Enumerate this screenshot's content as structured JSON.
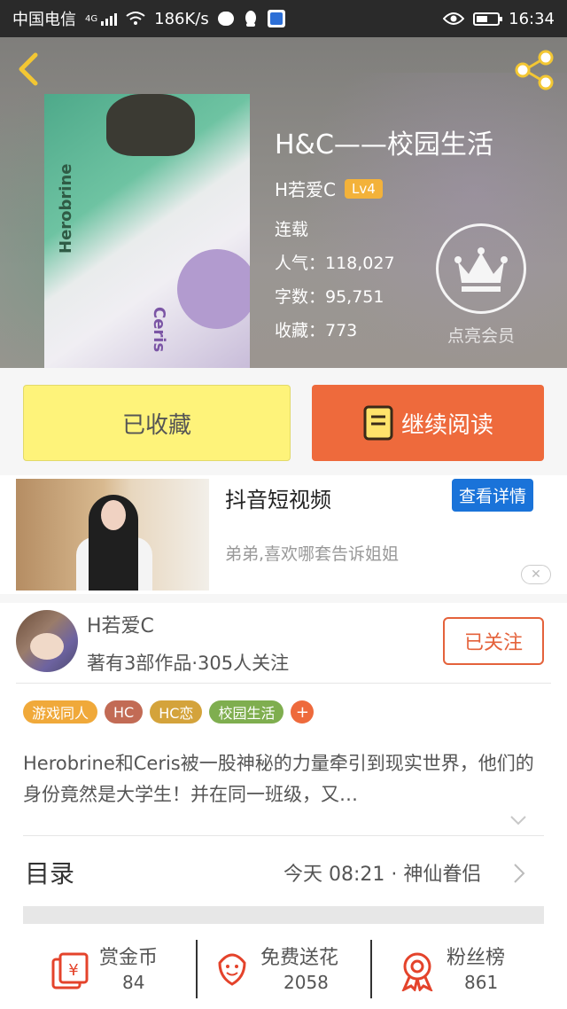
{
  "status_bar": {
    "carrier": "中国电信",
    "network": "4G",
    "speed": "186K/s",
    "time": "16:34"
  },
  "book": {
    "title": "H&C——校园生活",
    "author": "H若爱C",
    "level": "Lv4",
    "status": "连载",
    "popularity_label": "人气：118,027",
    "word_count_label": "字数：95,751",
    "favorites_label": "收藏：773",
    "cover_text_top": "Herobrine",
    "cover_text_bottom": "Ceris",
    "vip_label": "点亮会员"
  },
  "actions": {
    "collected": "已收藏",
    "continue_reading": "继续阅读"
  },
  "ad": {
    "title": "抖音短视频",
    "detail_button": "查看详情",
    "description": "弟弟,喜欢哪套告诉姐姐",
    "close": "✕"
  },
  "author_card": {
    "name": "H若爱C",
    "stats": "著有3部作品·305人关注",
    "follow_button": "已关注"
  },
  "tags": [
    {
      "label": "游戏同人",
      "color": "#f0a93a"
    },
    {
      "label": "HC",
      "color": "#c26b55"
    },
    {
      "label": "HC恋",
      "color": "#d4a33b"
    },
    {
      "label": "校园生活",
      "color": "#7fae4f"
    }
  ],
  "tag_add": "+",
  "description": "Herobrine和Ceris被一股神秘的力量牵引到现实世界，他们的身份竟然是大学生！并在同一班级，又…",
  "toc": {
    "label": "目录",
    "latest": "今天 08:21 · 神仙眷侣"
  },
  "bottom_bar": [
    {
      "label": "赏金币",
      "value": "84",
      "icon": "reward-coin-icon"
    },
    {
      "label": "免费送花",
      "value": "2058",
      "icon": "flower-icon"
    },
    {
      "label": "粉丝榜",
      "value": "861",
      "icon": "medal-icon"
    }
  ],
  "colors": {
    "accent": "#ee6a3c",
    "collected_bg": "#fef37a",
    "ad_button": "#1a73d9",
    "level_badge": "#f3b23a"
  }
}
